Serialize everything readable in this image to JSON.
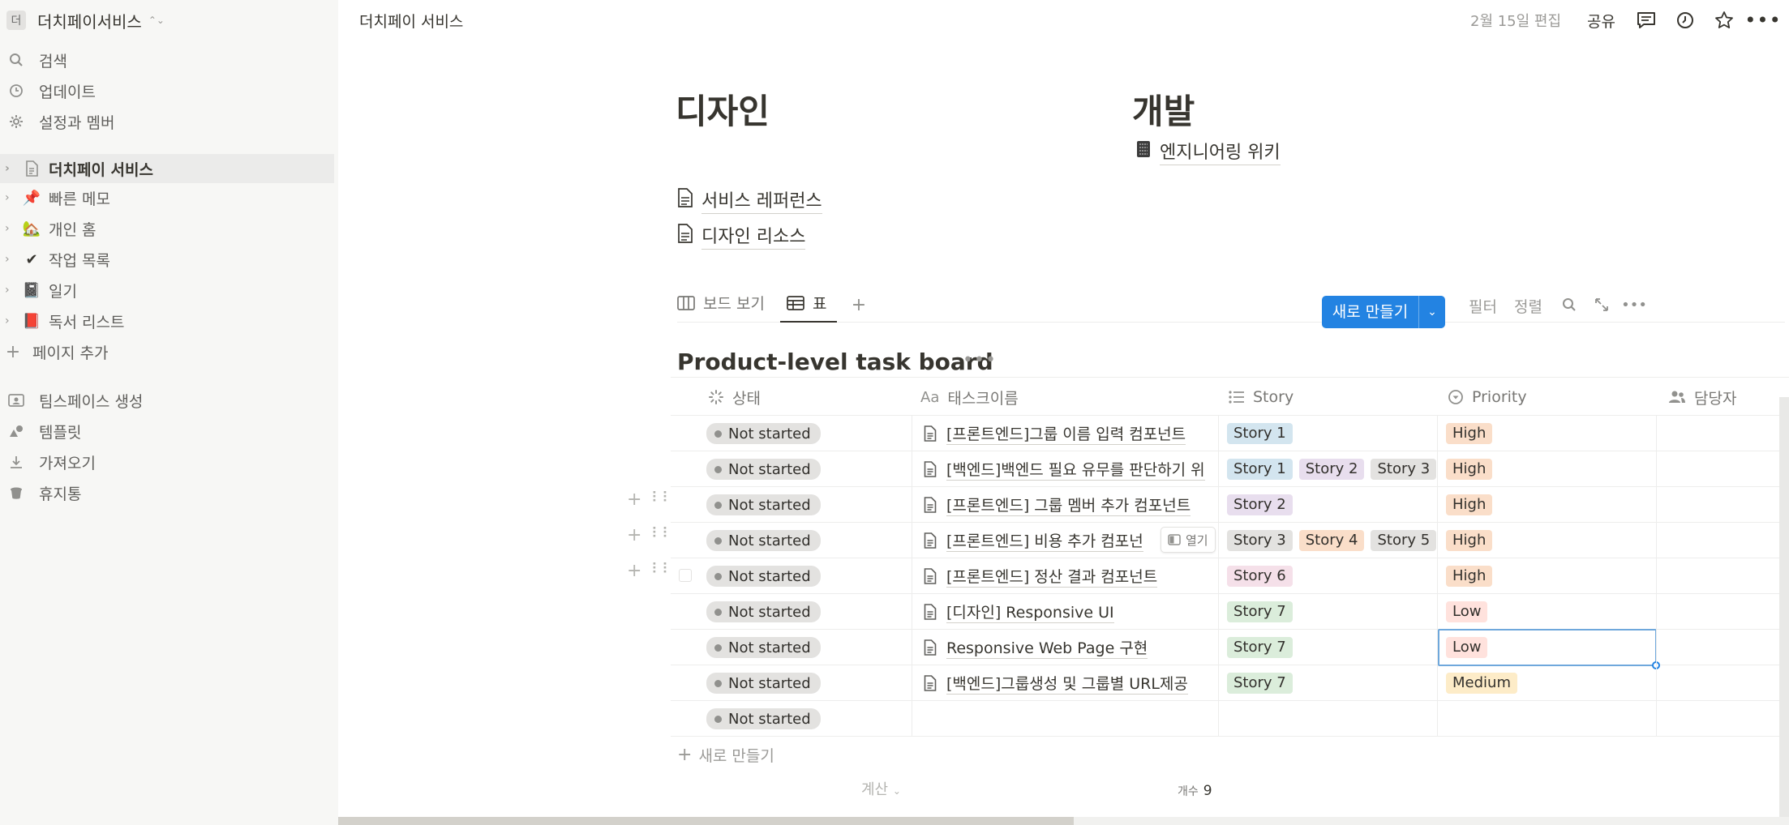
{
  "workspace": {
    "avatar": "더",
    "name": "더치페이서비스"
  },
  "sidebar": {
    "top": [
      {
        "label": "검색",
        "icon": "search-icon"
      },
      {
        "label": "업데이트",
        "icon": "clock-icon"
      },
      {
        "label": "설정과 멤버",
        "icon": "gear-icon"
      }
    ],
    "pages": [
      {
        "label": "더치페이 서비스",
        "emoji": "📄",
        "selected": true
      },
      {
        "label": "빠른 메모",
        "emoji": "📌"
      },
      {
        "label": "개인 홈",
        "emoji": "🏡"
      },
      {
        "label": "작업 목록",
        "emoji": "✔"
      },
      {
        "label": "일기",
        "emoji": "📓"
      },
      {
        "label": "독서 리스트",
        "emoji": "📕"
      }
    ],
    "add_page": "페이지 추가",
    "bottom": [
      {
        "label": "팀스페이스 생성",
        "icon": "teamspace-icon"
      },
      {
        "label": "템플릿",
        "icon": "template-icon"
      },
      {
        "label": "가져오기",
        "icon": "import-icon"
      },
      {
        "label": "휴지통",
        "icon": "trash-icon"
      }
    ]
  },
  "topbar": {
    "breadcrumb": "더치페이 서비스",
    "edited": "2월 15일 편집",
    "share": "공유"
  },
  "page": {
    "design_heading": "디자인",
    "dev_heading": "개발",
    "dev_links": [
      {
        "label": "엔지니어링 위키",
        "icon": "notebook-icon"
      }
    ],
    "design_links": [
      {
        "label": "서비스 레퍼런스",
        "icon": "page-icon"
      },
      {
        "label": "디자인 리소스",
        "icon": "page-icon"
      }
    ]
  },
  "views": {
    "tabs": [
      {
        "label": "보드 보기"
      },
      {
        "label": "표",
        "active": true
      }
    ],
    "filter": "필터",
    "sort": "정렬",
    "new_button": "새로 만들기"
  },
  "database": {
    "title": "Product-level task board",
    "columns": {
      "status": "상태",
      "task": "태스크이름",
      "story": "Story",
      "priority": "Priority",
      "assignee": "담당자"
    },
    "rows": [
      {
        "status": "Not started",
        "task": "[프론트엔드]그룹 이름 입력 컴포넌트",
        "stories": [
          "Story 1"
        ],
        "priority": "High"
      },
      {
        "status": "Not started",
        "task": "[백엔드]백엔드 필요 유무를 판단하기 위",
        "stories": [
          "Story 1",
          "Story 2",
          "Story 3"
        ],
        "priority": "High"
      },
      {
        "status": "Not started",
        "task": "[프론트엔드] 그룹 멤버 추가 컴포넌트",
        "stories": [
          "Story 2"
        ],
        "priority": "High"
      },
      {
        "status": "Not started",
        "task": "[프론트엔드] 비용 추가 컴포넌",
        "stories": [
          "Story 3",
          "Story 4",
          "Story 5"
        ],
        "priority": "High"
      },
      {
        "status": "Not started",
        "task": "[프론트엔드] 정산 결과 컴포넌트",
        "stories": [
          "Story 6"
        ],
        "priority": "High"
      },
      {
        "status": "Not started",
        "task": "[디자인] Responsive UI",
        "stories": [
          "Story 7"
        ],
        "priority": "Low"
      },
      {
        "status": "Not started",
        "task": "Responsive Web Page 구현",
        "stories": [
          "Story 7"
        ],
        "priority": "Low"
      },
      {
        "status": "Not started",
        "task": "[백엔드]그룹생성 및 그룹별 URL제공",
        "stories": [
          "Story 7"
        ],
        "priority": "Medium"
      },
      {
        "status": "Not started",
        "task": "",
        "stories": [],
        "priority": ""
      }
    ],
    "open_button": "열기",
    "add_row": "새로 만들기",
    "calc": "계산",
    "count_label": "개수",
    "count_value": "9"
  },
  "colors": {
    "accent": "#2383e2",
    "story": {
      "Story 1": "#d3e5ef",
      "Story 2": "#e8deee",
      "Story 3": "#e3e2e0",
      "Story 4": "#fadec9",
      "Story 5": "#e3e2e0",
      "Story 6": "#f5e0e9",
      "Story 7": "#dbeddb"
    },
    "priority": {
      "High": "#fadec9",
      "Low": "#ffe2dd",
      "Medium": "#fdecc8"
    }
  }
}
